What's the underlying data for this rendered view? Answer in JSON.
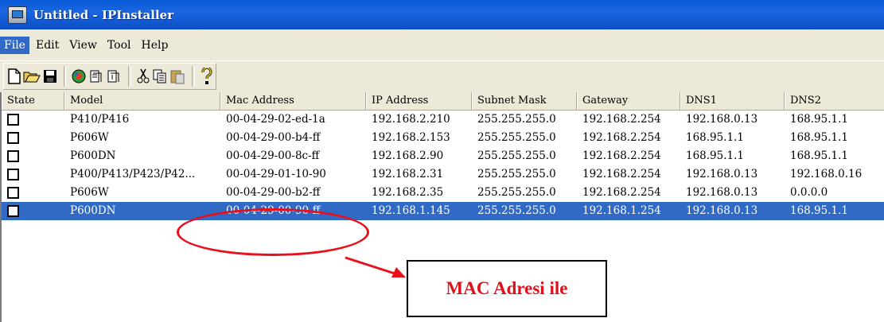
{
  "window": {
    "title": "Untitled - IPInstaller"
  },
  "menu": [
    {
      "label": "File",
      "active": true
    },
    {
      "label": "Edit"
    },
    {
      "label": "View"
    },
    {
      "label": "Tool"
    },
    {
      "label": "Help"
    }
  ],
  "toolbar": {
    "icons": [
      "new-file-icon",
      "open-folder-icon",
      "save-disk-icon",
      "search-device-icon",
      "config-icon",
      "config2-icon",
      "cut-icon",
      "copy-icon",
      "paste-icon",
      "help-icon"
    ]
  },
  "columns": [
    "State",
    "Model",
    "Mac Address",
    "IP Address",
    "Subnet Mask",
    "Gateway",
    "DNS1",
    "DNS2"
  ],
  "rows": [
    {
      "model": "P410/P416",
      "mac": "00-04-29-02-ed-1a",
      "ip": "192.168.2.210",
      "mask": "255.255.255.0",
      "gateway": "192.168.2.254",
      "dns1": "192.168.0.13",
      "dns2": "168.95.1.1",
      "selected": false
    },
    {
      "model": "P606W",
      "mac": "00-04-29-00-b4-ff",
      "ip": "192.168.2.153",
      "mask": "255.255.255.0",
      "gateway": "192.168.2.254",
      "dns1": "168.95.1.1",
      "dns2": "168.95.1.1",
      "selected": false
    },
    {
      "model": "P600DN",
      "mac": "00-04-29-00-8c-ff",
      "ip": "192.168.2.90",
      "mask": "255.255.255.0",
      "gateway": "192.168.2.254",
      "dns1": "168.95.1.1",
      "dns2": "168.95.1.1",
      "selected": false
    },
    {
      "model": "P400/P413/P423/P42...",
      "mac": "00-04-29-01-10-90",
      "ip": "192.168.2.31",
      "mask": "255.255.255.0",
      "gateway": "192.168.2.254",
      "dns1": "192.168.0.13",
      "dns2": "192.168.0.16",
      "selected": false
    },
    {
      "model": "P606W",
      "mac": "00-04-29-00-b2-ff",
      "ip": "192.168.2.35",
      "mask": "255.255.255.0",
      "gateway": "192.168.2.254",
      "dns1": "192.168.0.13",
      "dns2": "0.0.0.0",
      "selected": false
    },
    {
      "model": "P600DN",
      "mac": "00-04-29-00-90-ff",
      "ip": "192.168.1.145",
      "mask": "255.255.255.0",
      "gateway": "192.168.1.254",
      "dns1": "192.168.0.13",
      "dns2": "168.95.1.1",
      "selected": true
    }
  ],
  "annotation": {
    "callout": "MAC Adresi ile",
    "color": "#e8101a"
  },
  "colors": {
    "titlebar": "#0a5bd8",
    "selection": "#316ac5",
    "chrome": "#ece9d8"
  }
}
